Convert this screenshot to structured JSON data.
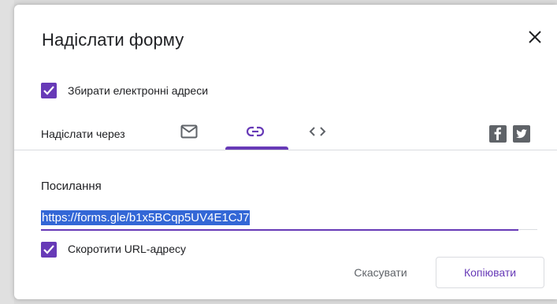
{
  "dialog": {
    "title": "Надіслати форму",
    "close_icon": "close-icon"
  },
  "collect_emails": {
    "label": "Збирати електронні адреси",
    "checked": true
  },
  "send_via": {
    "label": "Надіслати через",
    "tabs": [
      {
        "icon": "mail-icon",
        "selected": false
      },
      {
        "icon": "link-icon",
        "selected": true
      },
      {
        "icon": "embed-code-icon",
        "selected": false
      }
    ],
    "social": [
      {
        "icon": "facebook-icon"
      },
      {
        "icon": "twitter-icon"
      }
    ]
  },
  "link_section": {
    "heading": "Посилання",
    "url": "https://forms.gle/b1x5BCqp5UV4E1CJ7",
    "shorten_label": "Скоротити URL-адресу",
    "shorten_checked": true
  },
  "actions": {
    "cancel_label": "Скасувати",
    "copy_label": "Копіювати"
  },
  "colors": {
    "accent": "#673ab7",
    "selection": "#3367d6",
    "text": "#202124",
    "muted": "#5f6368"
  }
}
